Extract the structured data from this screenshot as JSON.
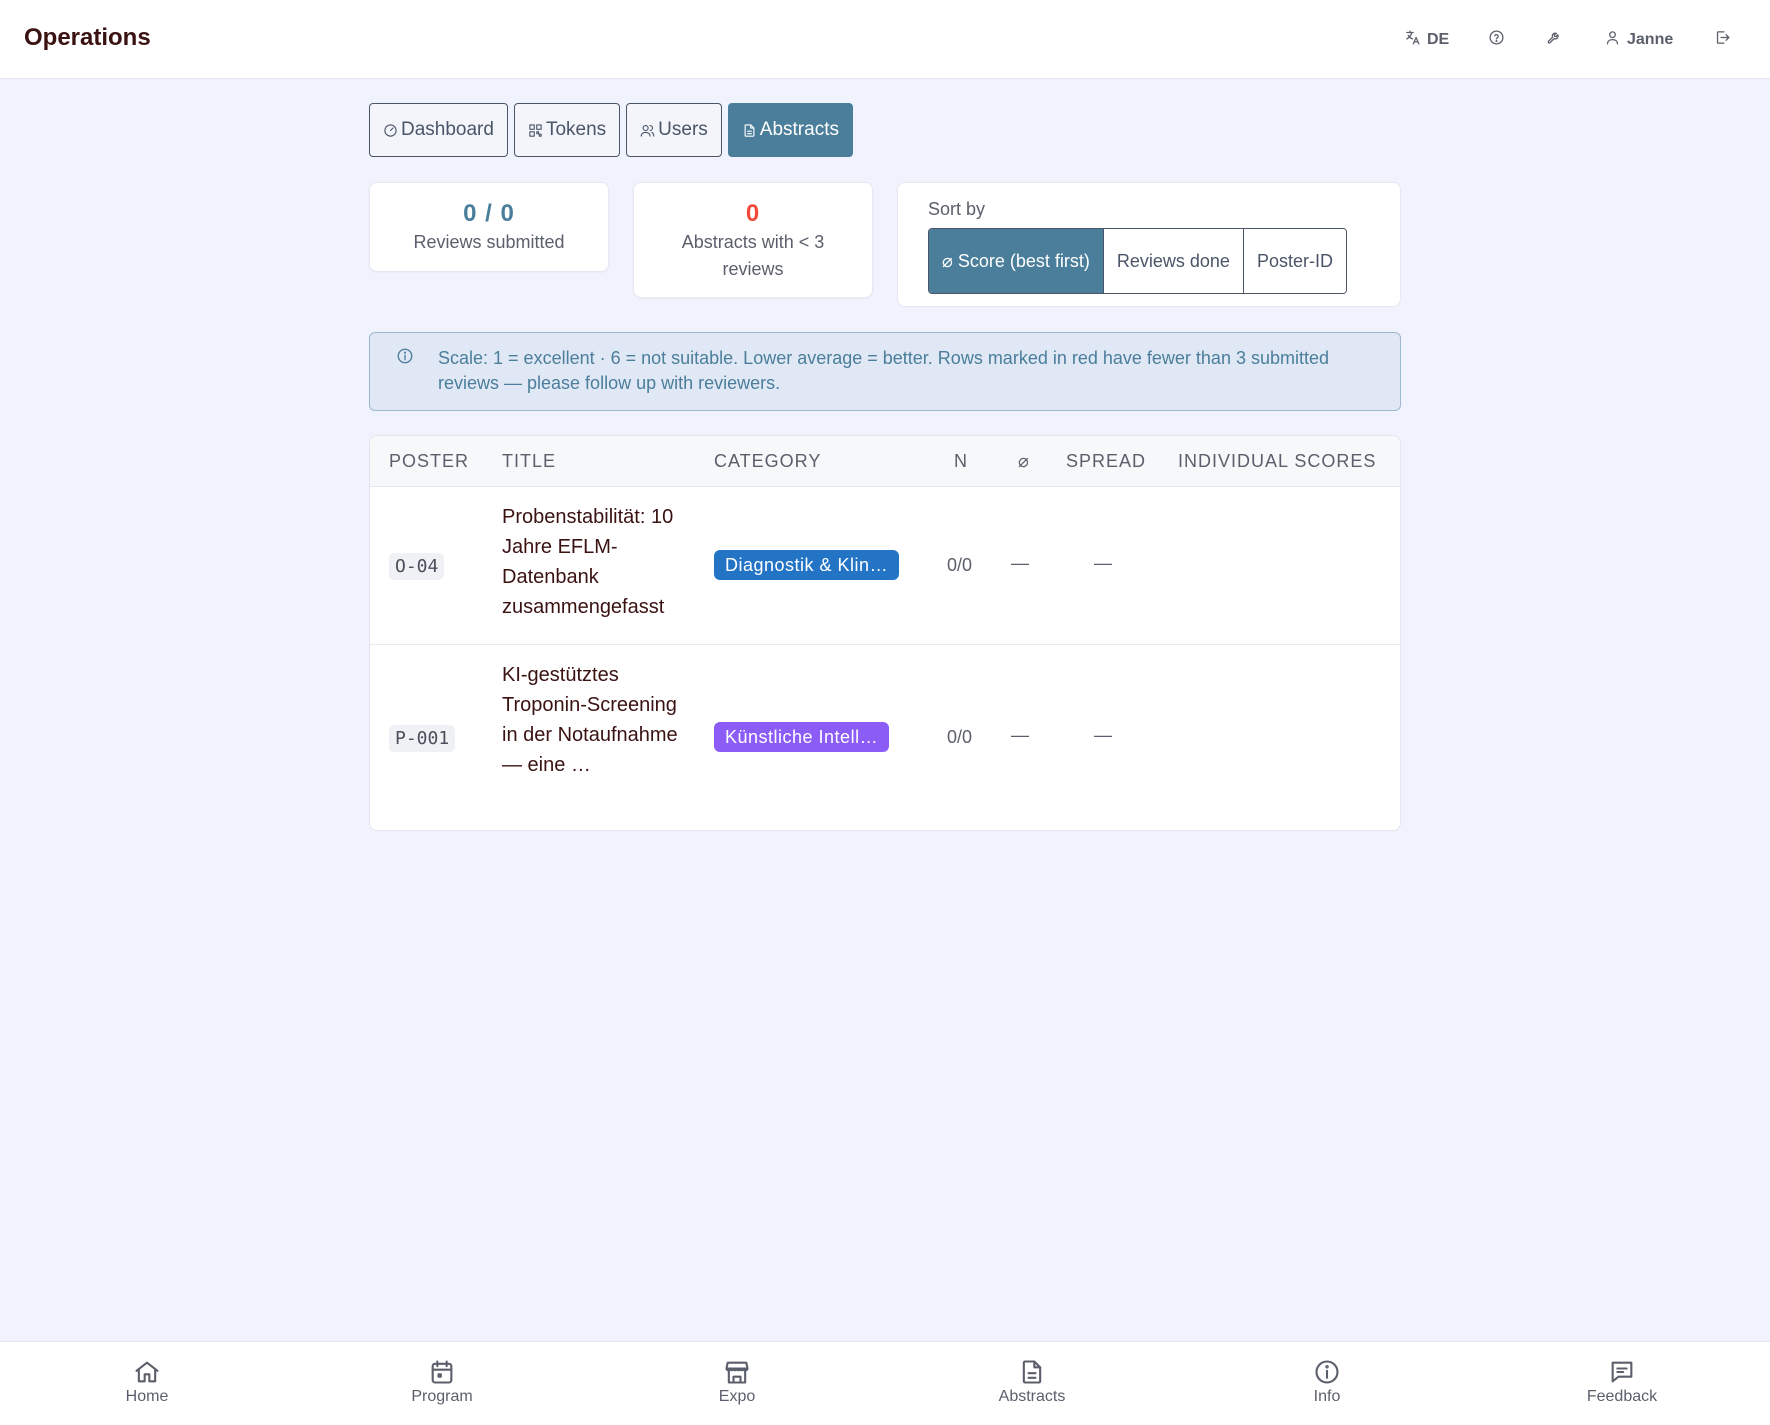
{
  "header": {
    "title": "Operations",
    "language": "DE",
    "user": "Janne"
  },
  "tabs": [
    {
      "label": "Dashboard",
      "icon": "gauge-icon"
    },
    {
      "label": "Tokens",
      "icon": "qr-code-icon"
    },
    {
      "label": "Users",
      "icon": "users-icon"
    },
    {
      "label": "Abstracts",
      "icon": "file-text-icon",
      "active": true
    }
  ],
  "stats": {
    "reviews_value": "0 / 0",
    "reviews_label": "Reviews submitted",
    "under_value": "0",
    "under_label": "Abstracts with < 3 reviews"
  },
  "sort": {
    "label": "Sort by",
    "options": [
      "⌀ Score (best first)",
      "Reviews done",
      "Poster-ID"
    ],
    "selected": "⌀ Score (best first)"
  },
  "info": {
    "text": "Scale: 1 = excellent · 6 = not suitable. Lower average = better. Rows marked in red have fewer than 3 submitted reviews — please follow up with reviewers."
  },
  "table": {
    "columns": [
      "POSTER",
      "TITLE",
      "CATEGORY",
      "N",
      "⌀",
      "SPREAD",
      "INDIVIDUAL SCORES"
    ],
    "rows": [
      {
        "poster": "O-04",
        "title": "Probenstabilität: 10 Jahre EFLM-Datenbank zusammengefasst",
        "category": "Diagnostik & Klin…",
        "category_color": "#2474c6",
        "n": "0/0",
        "avg": "—",
        "spread": "—",
        "scores": ""
      },
      {
        "poster": "P-001",
        "title": "KI-gestütztes Troponin-Screening in der Notaufnahme — eine …",
        "category": "Künstliche Intell…",
        "category_color": "#8b5cf6",
        "n": "0/0",
        "avg": "—",
        "spread": "—",
        "scores": ""
      }
    ]
  },
  "colors": {
    "accent": "#4a7e9b",
    "danger": "#ef4b3c",
    "background": "#f0f3fd"
  },
  "bottom_nav": [
    {
      "label": "Home",
      "icon": "home-icon"
    },
    {
      "label": "Program",
      "icon": "calendar-icon"
    },
    {
      "label": "Expo",
      "icon": "store-icon"
    },
    {
      "label": "Abstracts",
      "icon": "file-text-icon"
    },
    {
      "label": "Info",
      "icon": "info-icon"
    },
    {
      "label": "Feedback",
      "icon": "message-icon"
    }
  ]
}
